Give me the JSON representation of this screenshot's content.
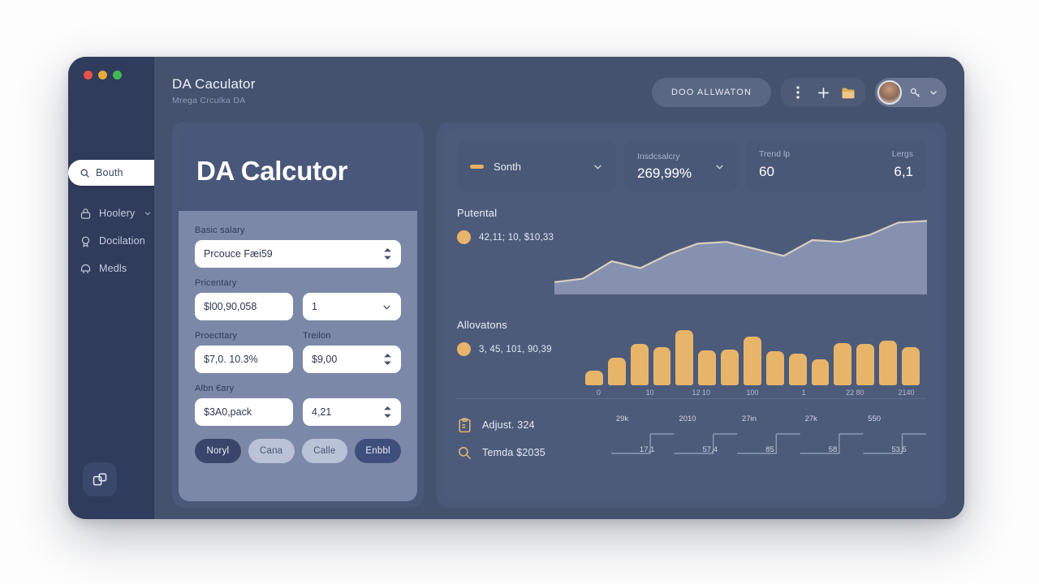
{
  "window": {
    "traffic_lights": [
      "close",
      "minimize",
      "maximize"
    ]
  },
  "sidebar": {
    "search": {
      "placeholder": "Bouth",
      "value": "Bouth",
      "icon": "search-icon"
    },
    "items": [
      {
        "label": "Hoolery",
        "icon": "lock-icon",
        "has_chevron": true
      },
      {
        "label": "Docilation",
        "icon": "badge-icon",
        "has_chevron": false
      },
      {
        "label": "Medls",
        "icon": "helmet-icon",
        "has_chevron": false
      }
    ],
    "fab": {
      "icon": "copy-windows-icon"
    }
  },
  "header": {
    "title": "DA Caculator",
    "subtitle": "Mrega Crculka DA",
    "pill_button": "DOO ALLWATON",
    "icons": [
      "more-vertical-icon",
      "plus-icon",
      "folder-icon"
    ],
    "avatar_chevron": "chevron-down-icon"
  },
  "calculator": {
    "title": "DA Calcutor",
    "fields": [
      {
        "label": "Basic salary",
        "value": "Prcouce Fæi59",
        "adorn": "stepper"
      },
      {
        "label": "Pricentary",
        "value": "$l00,90,058",
        "adorn": "none"
      },
      {
        "label": "",
        "value": "1",
        "adorn": "chevron"
      },
      {
        "label": "Proecttary",
        "value": "$7,0. 10.3%",
        "adorn": "none"
      },
      {
        "label": "Treilon",
        "value": "$9,00",
        "adorn": "stepper"
      },
      {
        "label": "Albn €ary",
        "value": "$3A0,pack",
        "adorn": "none"
      },
      {
        "label": "",
        "value": "4,21",
        "adorn": "stepper"
      }
    ],
    "buttons": [
      {
        "label": "Noryl",
        "style": "dark"
      },
      {
        "label": "Cana",
        "style": "light"
      },
      {
        "label": "Calle",
        "style": "light"
      },
      {
        "label": "Enbbl",
        "style": "accent"
      }
    ]
  },
  "stats": {
    "dropdown": {
      "label": "Sonth",
      "chevron": "chevron-down-icon"
    },
    "middle": {
      "label": "Insdcsalcry",
      "value": "269,99%",
      "chevron": "chevron-down-icon"
    },
    "right": [
      {
        "label": "Trend lp",
        "value": "60"
      },
      {
        "label": "Lergs",
        "value": "6,1"
      }
    ]
  },
  "sections": [
    {
      "title": "Putental",
      "legend": "42,11; 10, $10,33"
    },
    {
      "title": "Allovatons",
      "legend": "3, 45, 101, 90,39"
    }
  ],
  "footer_rows": [
    {
      "icon": "clipboard-icon",
      "text": "Adjust. 324"
    },
    {
      "icon": "search-icon",
      "text": "Temda $2035"
    }
  ],
  "mini_chart_labels": {
    "top": [
      "29k",
      "2010",
      "27in",
      "27k",
      "550"
    ],
    "bottom": [
      "17,1",
      "57,4",
      "85",
      "58",
      "53,5"
    ]
  },
  "colors": {
    "accent_gold": "#e7b56a",
    "window_bg": "#44526e",
    "sidebar_bg": "#2f3c5c",
    "card_bg": "#4a587a",
    "form_bg": "#7b88a8"
  },
  "chart_data": [
    {
      "type": "area",
      "title": "Putental",
      "legend": [
        "42,11; 10, $10,33"
      ],
      "x": [
        0,
        1,
        2,
        3,
        4,
        5,
        6,
        7,
        8,
        9,
        10,
        11,
        12,
        13
      ],
      "values": [
        14,
        18,
        38,
        30,
        46,
        58,
        60,
        52,
        44,
        62,
        60,
        68,
        82,
        84
      ],
      "ylim": [
        0,
        100
      ],
      "grid": false,
      "line_color": "#d9cfc0",
      "fill_color": "#8f9bb8"
    },
    {
      "type": "bar",
      "title": "Allovatons",
      "legend": [
        "3, 45, 101, 90,39"
      ],
      "categories": [
        "0",
        "",
        "10",
        "",
        "12",
        "10",
        "",
        "100",
        "",
        "1",
        "22",
        "80",
        "",
        "2140",
        ""
      ],
      "tick_labels": [
        "0",
        "10",
        "12 10",
        "100",
        "1",
        "22 80",
        "2140"
      ],
      "values": [
        18,
        35,
        52,
        48,
        70,
        44,
        45,
        62,
        43,
        40,
        33,
        53,
        52,
        56,
        48
      ],
      "ylim": [
        0,
        80
      ],
      "grid": false,
      "bar_color": "#e7b56a"
    },
    {
      "type": "line",
      "title": "mini-step-chart",
      "labels_top": [
        "29k",
        "2010",
        "27in",
        "27k",
        "550"
      ],
      "labels_bottom": [
        "17,1",
        "57,4",
        "85",
        "58",
        "53,5"
      ],
      "grid": false
    }
  ]
}
